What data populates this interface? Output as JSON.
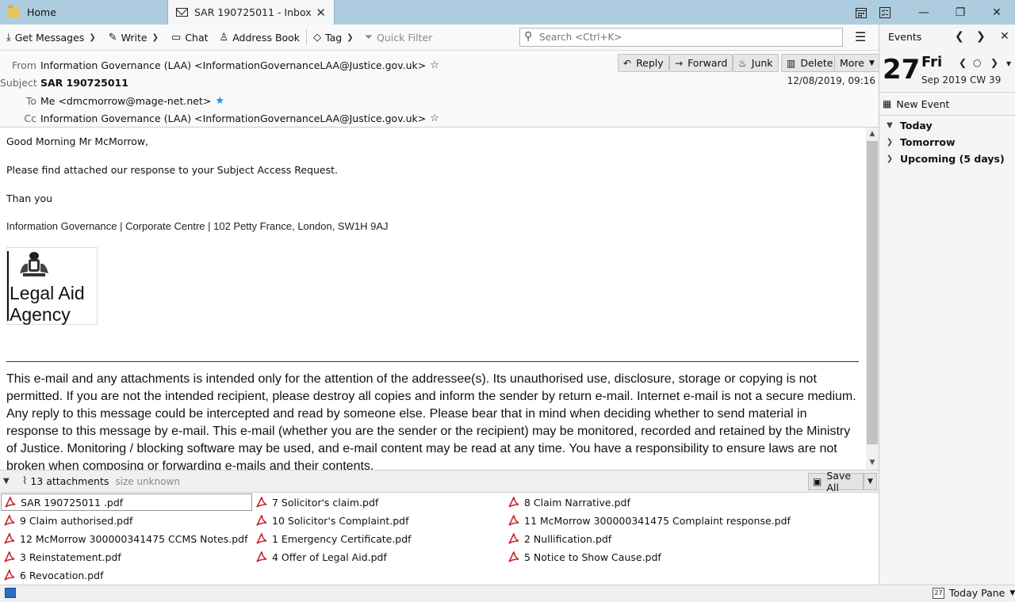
{
  "tabs": {
    "home": "Home",
    "mail": "SAR 190725011 - Inbox - dmcmorrow@mage-net.net"
  },
  "toolbar": {
    "get_messages": "Get Messages",
    "write": "Write",
    "chat": "Chat",
    "address_book": "Address Book",
    "tag": "Tag",
    "quick_filter": "Quick Filter",
    "search_placeholder": "Search <Ctrl+K>"
  },
  "header": {
    "from_label": "From",
    "from_value": "Information Governance (LAA) <InformationGovernanceLAA@Justice.gov.uk>",
    "subject_label": "Subject",
    "subject_value": "SAR 190725011",
    "to_label": "To",
    "to_value": "Me <dmcmorrow@mage-net.net>",
    "cc_label": "Cc",
    "cc_value": "Information Governance (LAA) <InformationGovernanceLAA@Justice.gov.uk>",
    "date": "12/08/2019, 09:16",
    "buttons": {
      "reply": "Reply",
      "forward": "Forward",
      "junk": "Junk",
      "delete": "Delete",
      "more": "More"
    }
  },
  "body": {
    "greeting": "Good Morning Mr McMorrow,",
    "line1": "Please find attached our response to your Subject Access Request.",
    "line2": "Than you",
    "signature": "Information Governance | Corporate Centre | 102 Petty France, London, SW1H 9AJ",
    "logo_text_line1": "Legal Aid",
    "logo_text_line2": "Agency",
    "disclaimer": "This e-mail and any attachments is intended only for the attention of the addressee(s). Its unauthorised use, disclosure, storage or copying is not permitted. If you are not the intended recipient, please destroy all copies and inform the sender by return e-mail. Internet e-mail is not a secure medium. Any reply to this message could be intercepted and read by someone else. Please bear that in mind when deciding whether to send material in response to this message by e-mail. This e-mail (whether you are the sender or the recipient) may be monitored, recorded and retained by the Ministry of Justice. Monitoring / blocking software may be used, and e-mail content may be read at any time. You have a responsibility to ensure laws are not broken when composing or forwarding e-mails and their contents."
  },
  "attachments": {
    "count_label": "13 attachments",
    "size_label": "size unknown",
    "save_all": "Save All",
    "files": [
      "SAR 190725011 .pdf",
      "7 Solicitor's claim.pdf",
      "8 Claim Narrative.pdf",
      "9 Claim authorised.pdf",
      "10 Solicitor's Complaint.pdf",
      "11 McMorrow 300000341475 Complaint response.pdf",
      "12 McMorrow 300000341475 CCMS Notes.pdf",
      "1 Emergency Certificate.pdf",
      "2 Nullification.pdf",
      "3 Reinstatement.pdf",
      "4 Offer of Legal Aid.pdf",
      "5 Notice to Show Cause.pdf",
      "6 Revocation.pdf"
    ]
  },
  "today_pane": {
    "title": "Events",
    "day_number": "27",
    "weekday": "Fri",
    "month_year": "Sep 2019",
    "week": "CW 39",
    "new_event": "New Event",
    "groups": [
      "Today",
      "Tomorrow",
      "Upcoming (5 days)"
    ]
  },
  "statusbar": {
    "today_pane": "Today Pane",
    "cal_icon_day": "27"
  },
  "colors": {
    "tabbar": "#aeccdf",
    "pdf_red": "#c8202a",
    "star_blue": "#1c8cf0"
  }
}
